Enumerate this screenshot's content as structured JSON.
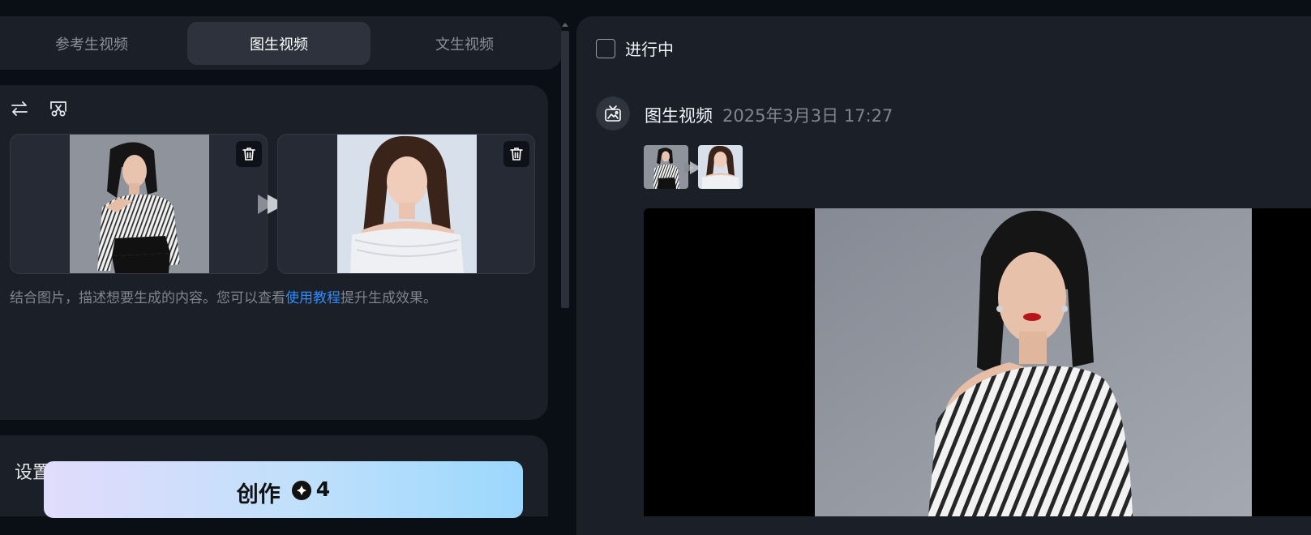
{
  "mode_tabs": [
    {
      "label": "参考生视频",
      "active": false
    },
    {
      "label": "图生视频",
      "active": true
    },
    {
      "label": "文生视频",
      "active": false
    }
  ],
  "input": {
    "toolbar_icons": [
      "swap-icon",
      "crop-icon"
    ],
    "frames": [
      {
        "name": "first-frame",
        "delete_icon": "trash-icon"
      },
      {
        "name": "last-frame",
        "delete_icon": "trash-icon"
      }
    ],
    "prompt_before_link": "结合图片，描述想要生成的内容。您可以查看",
    "prompt_link": "使用教程",
    "prompt_after_link": "提升生成效果。"
  },
  "settings": {
    "title": "设置"
  },
  "create_button": {
    "label": "创作",
    "cost": "4",
    "cost_icon": "credit-icon"
  },
  "results": {
    "filter_label": "进行中",
    "filter_checked": false,
    "task": {
      "type": "图生视频",
      "time": "2025年3月3日 17:27",
      "icon": "tv-icon"
    }
  },
  "colors": {
    "page_bg": "#0a0e15",
    "panel_bg": "#1b1f28",
    "active_tab_bg": "#2d323d",
    "link": "#2e8bff",
    "create_gradient_start": "#e1dcfb",
    "create_gradient_end": "#9bd8fd"
  }
}
